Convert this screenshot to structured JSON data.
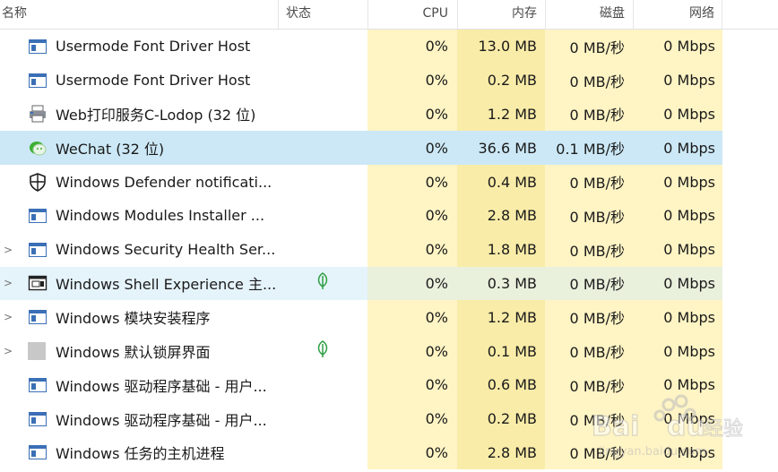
{
  "header": {
    "name": "名称",
    "status": "状态",
    "cpu": "CPU",
    "memory": "内存",
    "disk": "磁盘",
    "network": "网络"
  },
  "rows": [
    {
      "name": "Usermode Font Driver Host",
      "cpu": "0%",
      "memory": "13.0 MB",
      "disk": "0 MB/秒",
      "network": "0 Mbps",
      "icon": "window-app-icon",
      "expander": false,
      "status_icon": null,
      "state": ""
    },
    {
      "name": "Usermode Font Driver Host",
      "cpu": "0%",
      "memory": "0.2 MB",
      "disk": "0 MB/秒",
      "network": "0 Mbps",
      "icon": "window-app-icon",
      "expander": false,
      "status_icon": null,
      "state": ""
    },
    {
      "name": "Web打印服务C-Lodop (32 位)",
      "cpu": "0%",
      "memory": "1.2 MB",
      "disk": "0 MB/秒",
      "network": "0 Mbps",
      "icon": "printer-icon",
      "expander": false,
      "status_icon": null,
      "state": ""
    },
    {
      "name": "WeChat (32 位)",
      "cpu": "0%",
      "memory": "36.6 MB",
      "disk": "0.1 MB/秒",
      "network": "0 Mbps",
      "icon": "wechat-icon",
      "expander": false,
      "status_icon": null,
      "state": "selected"
    },
    {
      "name": "Windows Defender notificati...",
      "cpu": "0%",
      "memory": "0.4 MB",
      "disk": "0 MB/秒",
      "network": "0 Mbps",
      "icon": "shield-icon",
      "expander": false,
      "status_icon": null,
      "state": ""
    },
    {
      "name": "Windows Modules Installer ...",
      "cpu": "0%",
      "memory": "2.8 MB",
      "disk": "0 MB/秒",
      "network": "0 Mbps",
      "icon": "window-app-icon",
      "expander": false,
      "status_icon": null,
      "state": ""
    },
    {
      "name": "Windows Security Health Ser...",
      "cpu": "0%",
      "memory": "1.8 MB",
      "disk": "0 MB/秒",
      "network": "0 Mbps",
      "icon": "window-app-icon",
      "expander": true,
      "status_icon": null,
      "state": ""
    },
    {
      "name": "Windows Shell Experience 主...",
      "cpu": "0%",
      "memory": "0.3 MB",
      "disk": "0 MB/秒",
      "network": "0 Mbps",
      "icon": "shell-window-icon",
      "expander": true,
      "status_icon": "leaf-icon",
      "state": "hover"
    },
    {
      "name": "Windows 模块安装程序",
      "cpu": "0%",
      "memory": "1.2 MB",
      "disk": "0 MB/秒",
      "network": "0 Mbps",
      "icon": "window-app-icon",
      "expander": true,
      "status_icon": null,
      "state": ""
    },
    {
      "name": "Windows 默认锁屏界面",
      "cpu": "0%",
      "memory": "0.1 MB",
      "disk": "0 MB/秒",
      "network": "0 Mbps",
      "icon": "grey-square-icon",
      "expander": true,
      "status_icon": "leaf-icon",
      "state": ""
    },
    {
      "name": "Windows 驱动程序基础 - 用户...",
      "cpu": "0%",
      "memory": "0.6 MB",
      "disk": "0 MB/秒",
      "network": "0 Mbps",
      "icon": "window-app-icon",
      "expander": false,
      "status_icon": null,
      "state": ""
    },
    {
      "name": "Windows 驱动程序基础 - 用户...",
      "cpu": "0%",
      "memory": "0.2 MB",
      "disk": "0 MB/秒",
      "network": "0 Mbps",
      "icon": "window-app-icon",
      "expander": false,
      "status_icon": null,
      "state": ""
    },
    {
      "name": "Windows 任务的主机进程",
      "cpu": "0%",
      "memory": "2.8 MB",
      "disk": "0 MB/秒",
      "network": "0 Mbps",
      "icon": "window-app-icon",
      "expander": false,
      "status_icon": null,
      "state": ""
    }
  ],
  "watermark": {
    "brand": "Bai du 经验",
    "url": "jingyan.baidu.com"
  },
  "colors": {
    "heat_light": "#fff4c4",
    "heat_mid": "#f9eca8",
    "selected": "#cce8f6",
    "leaf": "#2e9e44"
  }
}
